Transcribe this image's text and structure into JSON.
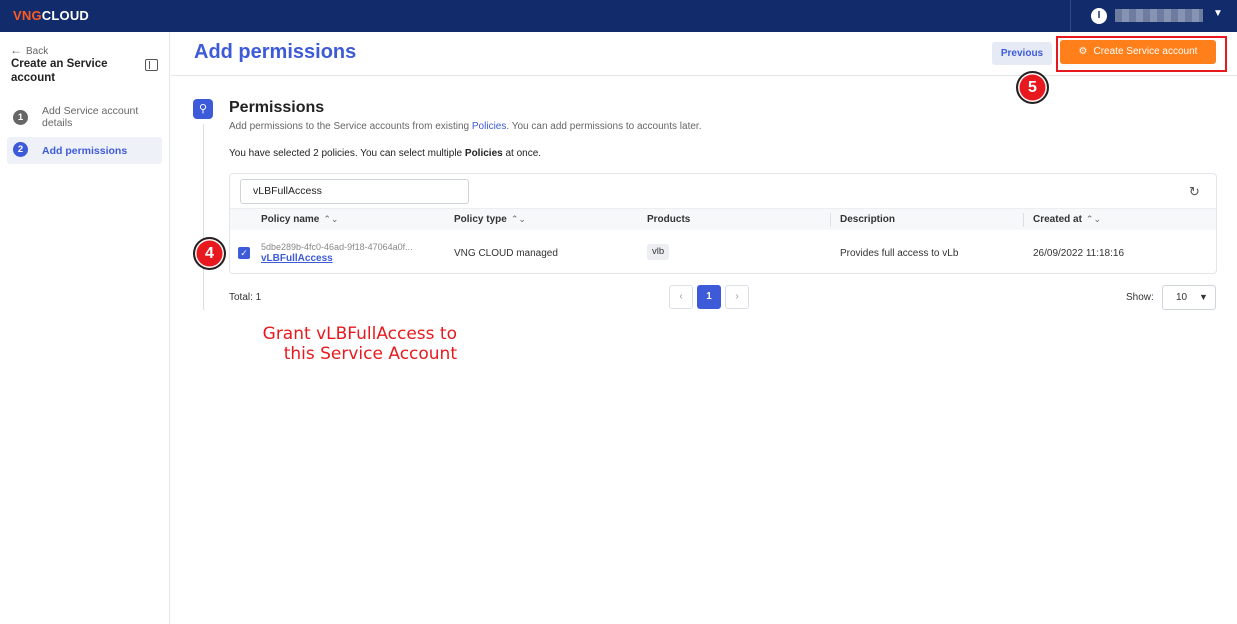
{
  "header": {
    "logo_brand": "VNG",
    "logo_cloud": "CLOUD",
    "user_initial": "I",
    "user_caret": "▼"
  },
  "sidebar": {
    "back_arrow": "←",
    "back_label": "Back",
    "title": "Create an Service account",
    "steps": [
      {
        "num": "1",
        "label": "Add Service account details"
      },
      {
        "num": "2",
        "label": "Add permissions"
      }
    ]
  },
  "page": {
    "title": "Add permissions",
    "previous_label": "Previous",
    "create_label": "Create Service account",
    "create_icon": "user-gear-icon"
  },
  "markers": {
    "step4": "4",
    "step5": "5"
  },
  "permissions": {
    "title": "Permissions",
    "subtitle_prefix": "Add permissions to the Service accounts from existing ",
    "subtitle_link": "Policies",
    "subtitle_suffix": ". You can add permissions to accounts later.",
    "selected_prefix": "You have selected 2 policies. You can select multiple ",
    "selected_bold": "Policies",
    "selected_suffix": " at once."
  },
  "table": {
    "search_value": "vLBFullAccess",
    "columns": [
      "Policy name",
      "Policy type",
      "Products",
      "Description",
      "Created at"
    ],
    "sort_glyph": "⌃⌄",
    "rows": [
      {
        "checked": true,
        "id": "5dbe289b-4fc0-46ad-9f18-47064a0f...",
        "name": "vLBFullAccess",
        "type": "VNG CLOUD managed",
        "product": "vlb",
        "description": "Provides full access to vLb",
        "created_at": "26/09/2022 11:18:16"
      }
    ]
  },
  "footer": {
    "total": "Total: 1",
    "prev": "‹",
    "page": "1",
    "next": "›",
    "show_label": "Show:",
    "show_value": "10",
    "show_caret": "▼"
  },
  "annotation": "Grant vLBFullAccess to this Service Account",
  "colors": {
    "topbar": "#122c6b",
    "accent": "#3d5bd9",
    "primary_button": "#ff7f1a",
    "marker_red": "#e8191e"
  }
}
